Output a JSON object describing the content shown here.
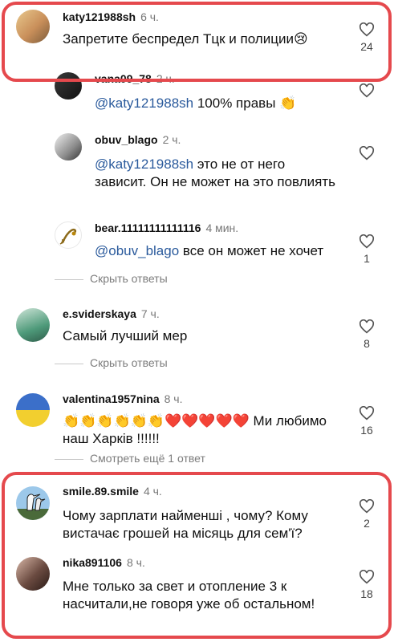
{
  "comments": [
    {
      "user": "katy121988sh",
      "time": "6 ч.",
      "text": "Запретите беспредел Тцк и полиции😢",
      "likes": "24"
    },
    {
      "user": "vana09_78",
      "time": "2 ч.",
      "mention": "@katy121988sh",
      "text": " 100% правы 👏"
    },
    {
      "user": "obuv_blago",
      "time": "2 ч.",
      "mention": "@katy121988sh",
      "text": "  это не от него зависит. Он не может на это повлиять"
    },
    {
      "user": "bear.11111111111116",
      "time": "4 мин.",
      "mention": "@obuv_blago",
      "text": " все он может не хочет",
      "likes": "1"
    },
    {
      "user": "e.sviderskaya",
      "time": "7 ч.",
      "text": "Самый лучший мер",
      "likes": "8"
    },
    {
      "user": "valentina1957nina",
      "time": "8 ч.",
      "text": "👏👏👏👏👏👏❤️❤️❤️❤️❤️ Ми любимо наш Харків !!!!!!",
      "likes": "16"
    },
    {
      "user": "smile.89.smile",
      "time": "4 ч.",
      "text": "Чому зарплати найменші , чому? Кому вистачає грошей на місяць для сем'ї?",
      "likes": "2"
    },
    {
      "user": "nika891106",
      "time": "8 ч.",
      "text": "Мне только за свет и отопление 3 к насчитали,не говоря уже об остальном!",
      "likes": "18"
    }
  ],
  "links": {
    "hide_replies_1": "Скрыть ответы",
    "hide_replies_2": "Скрыть ответы",
    "view_more": "Смотреть ещё 1 ответ"
  },
  "colors": {
    "highlight": "#e5494d",
    "mention": "#2a5a9c"
  }
}
